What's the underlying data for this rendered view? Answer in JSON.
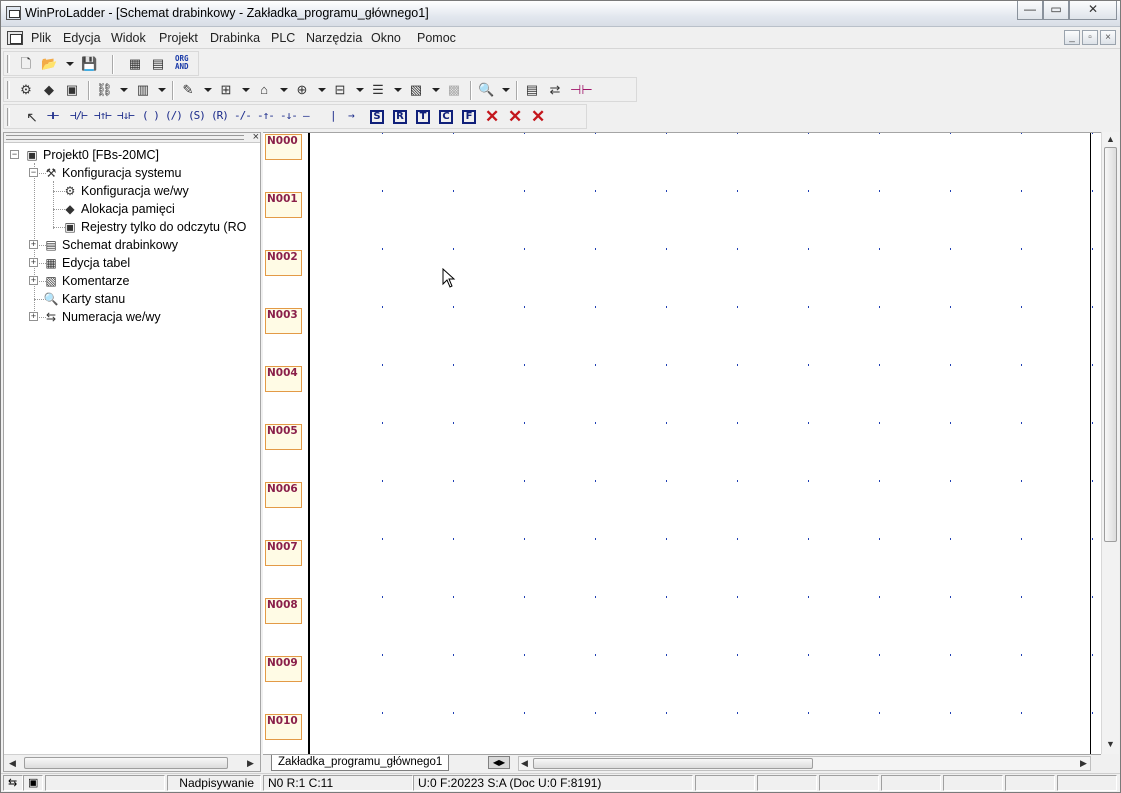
{
  "window": {
    "title": "WinProLadder - [Schemat drabinkowy - Zakładka_programu_głównego1]",
    "controls": [
      "—",
      "▭",
      "✕"
    ]
  },
  "menu": {
    "items": [
      "Plik",
      "Edycja",
      "Widok",
      "Projekt",
      "Drabinka",
      "PLC",
      "Narzędzia",
      "Okno",
      "Pomoc"
    ],
    "mdi_controls": [
      "_",
      "▫",
      "×"
    ]
  },
  "toolbar1": {
    "org_label": "ORG",
    "and_label": "AND"
  },
  "toolbar3": {
    "boxes": [
      "S",
      "R",
      "T",
      "C",
      "F"
    ]
  },
  "tree": {
    "items": [
      {
        "label": "Projekt0 [FBs-20MC]"
      },
      {
        "label": "Konfiguracja systemu"
      },
      {
        "label": "Konfiguracja we/wy"
      },
      {
        "label": "Alokacja pamięci"
      },
      {
        "label": "Rejestry tylko do odczytu (RO"
      },
      {
        "label": "Schemat drabinkowy"
      },
      {
        "label": "Edycja tabel"
      },
      {
        "label": "Komentarze"
      },
      {
        "label": "Karty stanu"
      },
      {
        "label": "Numeracja we/wy"
      }
    ]
  },
  "ladder": {
    "networks": [
      "N000",
      "N001",
      "N002",
      "N003",
      "N004",
      "N005",
      "N006",
      "N007",
      "N008",
      "N009",
      "N010"
    ]
  },
  "tabs": {
    "active": "Zakładka_programu_głównego1"
  },
  "status": {
    "mode": "Nadpisywanie",
    "position": "N0 R:1 C:11",
    "memory": "U:0 F:20223 S:A (Doc U:0 F:8191)"
  },
  "colors": {
    "network_label_text": "#8a1f4a",
    "network_label_border": "#e39a46",
    "grid_dot": "#1f3fb4",
    "delete_icon": "#c4161c"
  }
}
